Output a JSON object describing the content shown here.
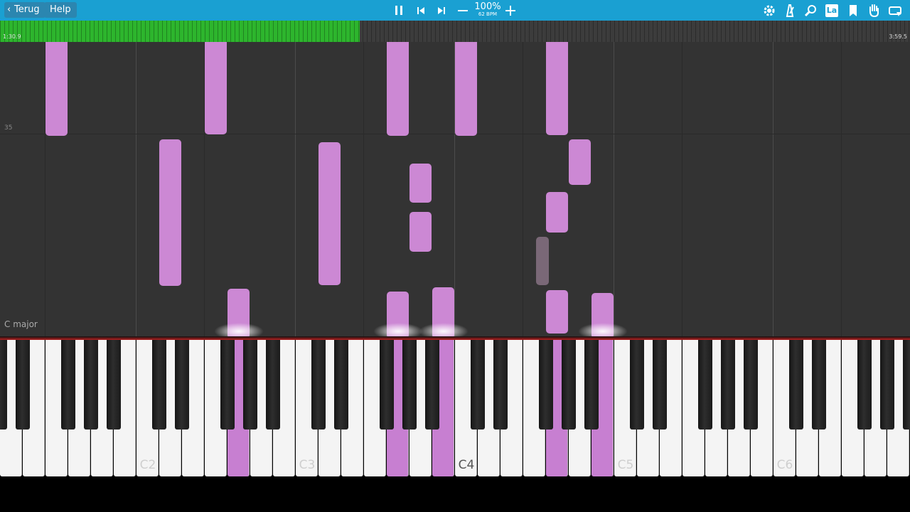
{
  "toolbar": {
    "back_label": "Terug",
    "help_label": "Help",
    "tempo_percent": "100%",
    "tempo_bpm": "62 BPM",
    "icons": [
      "pause-icon",
      "skip-back-icon",
      "skip-forward-icon",
      "minus-icon",
      "plus-icon",
      "gear-icon",
      "metronome-icon",
      "magnifier-icon",
      "label-icon",
      "bookmark-icon",
      "hand-icon",
      "loop-icon"
    ],
    "label_icon_text": "La"
  },
  "progress": {
    "start_time": "1:30.9",
    "end_time": "3:59.5",
    "fraction": 0.395,
    "fill_color": "#2db52d"
  },
  "roll": {
    "measure_number": "35",
    "key_signature": "C major",
    "note_color": "#cc88d4"
  },
  "keyboard": {
    "octave_labels": [
      "C2",
      "C3",
      "C4",
      "C5",
      "C6"
    ],
    "pressed_color": "#c77fd1"
  }
}
